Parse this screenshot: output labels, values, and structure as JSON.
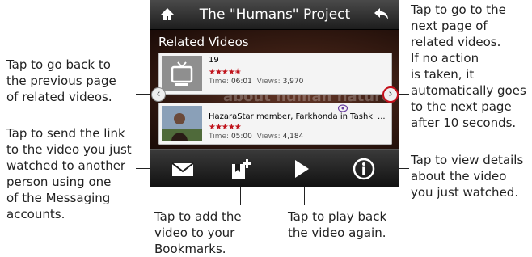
{
  "header": {
    "title": "The \"Humans\" Project",
    "home_icon": "home-icon",
    "back_icon": "back-arrow-icon"
  },
  "content": {
    "heading": "Related Videos",
    "watermark": "about human nature"
  },
  "videos": [
    {
      "title": "19",
      "rating": "★★★★✬",
      "time_label": "Time:",
      "time": "06:01",
      "views_label": "Views:",
      "views": "3,970"
    },
    {
      "title": "HazaraStar member, Farkhonda in Tashki ...",
      "rating": "★★★★★",
      "time_label": "Time:",
      "time": "05:00",
      "views_label": "Views:",
      "views": "4,184"
    }
  ],
  "toolbar": {
    "icons": [
      "mail-icon",
      "bookmark-add-icon",
      "play-icon",
      "info-icon"
    ]
  },
  "callouts": {
    "prev_page": [
      "Tap to go back to",
      "the previous page",
      "of related videos."
    ],
    "send_link": [
      "Tap to send the link",
      "to the video you just",
      "watched to another",
      "person using one",
      "of the Messaging",
      "accounts."
    ],
    "next_page": [
      "Tap to go to the",
      "next page of",
      "related videos.",
      "If no action",
      "is taken, it",
      "automatically goes",
      "to the next page",
      "after 10 seconds."
    ],
    "details": [
      "Tap to view details",
      "about the video",
      "you just watched."
    ],
    "bookmark": [
      "Tap to add the",
      "video to your",
      "Bookmarks."
    ],
    "play_again": [
      "Tap to play back",
      "the video again."
    ]
  },
  "colors": {
    "rating_red": "#c0141c",
    "next_ring": "#c40f1a"
  }
}
